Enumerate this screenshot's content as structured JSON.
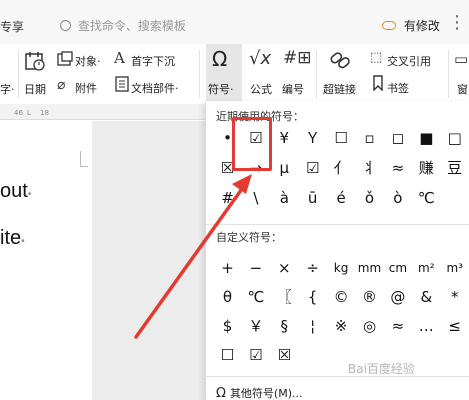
{
  "topbar": {
    "left_tab": "专享",
    "search_placeholder": "查找命令、搜索模板",
    "modify_label": "有修改",
    "more_icon": "⋮"
  },
  "ribbon": {
    "left_partial_label": "字·",
    "date_label": "日期",
    "object_label": "对象·",
    "attachment_label": "附件",
    "dropcap_label": "首字下沉",
    "docpart_label": "文档部件·",
    "symbol_label": "符号·",
    "formula_label": "公式",
    "numbering_label": "编号",
    "hyperlink_label": "超链接",
    "crossref_label": "交叉引用",
    "bookmark_label": "书签",
    "window_label": "窗"
  },
  "ruler": {
    "ticks": [
      "46",
      "L",
      "18"
    ]
  },
  "document": {
    "word1": "out",
    "word2": "ite"
  },
  "panel": {
    "recent_title": "近期使用的符号：",
    "recent": [
      [
        "•",
        "☑",
        "¥",
        "Ｙ",
        "☐",
        "▫",
        "◻",
        "■",
        "□"
      ],
      [
        "☒",
        "→",
        "μ",
        "☑",
        "亻",
        "丬",
        "≈",
        "赚",
        "豆"
      ],
      [
        "#",
        "\\",
        "à",
        "ū",
        "é",
        "ǒ",
        "ò",
        "℃",
        ""
      ]
    ],
    "custom_title": "自定义符号：",
    "custom": [
      [
        "+",
        "−",
        "×",
        "÷",
        "kg",
        "mm",
        "cm",
        "m²",
        "m³"
      ],
      [
        "θ",
        "℃",
        "〖",
        "{",
        "©",
        "®",
        "@",
        "&",
        "*"
      ],
      [
        "$",
        "￥",
        "§",
        "¦",
        "※",
        "◎",
        "≈",
        "…",
        "≤"
      ],
      [
        "☐",
        "☑",
        "☒",
        "",
        "",
        "",
        "",
        "",
        ""
      ]
    ],
    "other_label": "其他符号(M)...",
    "other_icon": "Ω"
  },
  "watermark": "Bai百度经验",
  "colors": {
    "highlight": "#e53a2f",
    "arrow": "#e53a2f",
    "panel_bg": "#ffffff"
  }
}
